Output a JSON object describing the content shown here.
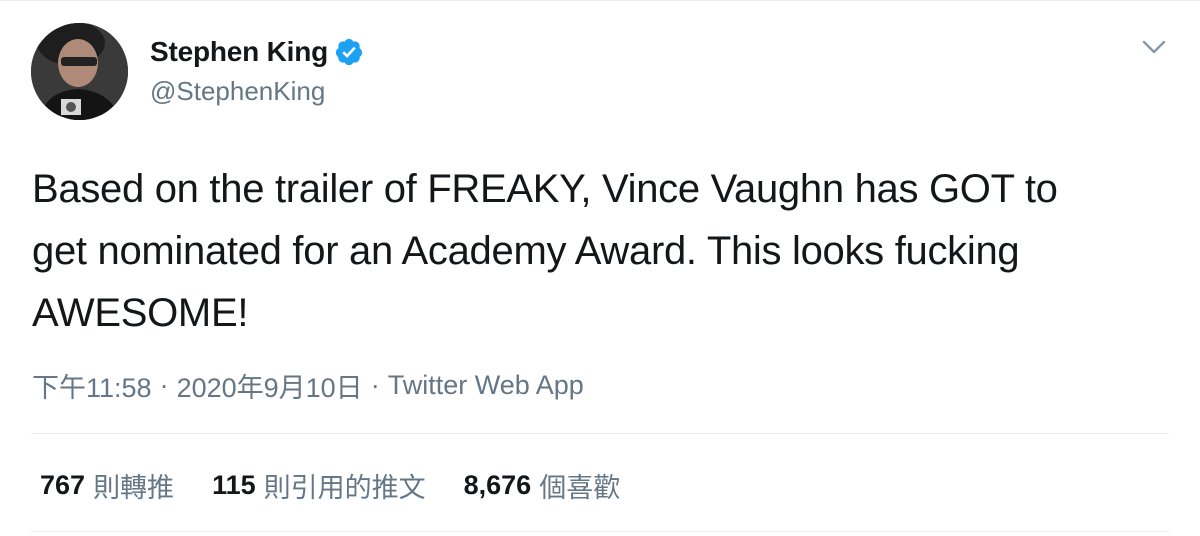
{
  "user": {
    "display_name": "Stephen King",
    "handle": "@StephenKing",
    "verified": true
  },
  "tweet": {
    "text": "Based on the trailer of FREAKY, Vince Vaughn has GOT to\nget nominated for an Academy Award. This looks fucking\nAWESOME!",
    "time": "下午11:58",
    "date": "2020年9月10日",
    "separator": "·",
    "source": "Twitter Web App"
  },
  "stats": {
    "retweets": {
      "count": "767",
      "label": "則轉推"
    },
    "quotes": {
      "count": "115",
      "label": "則引用的推文"
    },
    "likes": {
      "count": "8,676",
      "label": "個喜歡"
    }
  },
  "icons": {
    "verified": "verified-badge-icon",
    "caret": "chevron-down-icon"
  },
  "colors": {
    "verified_blue": "#1da1f2",
    "text_primary": "#14171a",
    "text_secondary": "#657786",
    "divider": "#e6ecf0"
  }
}
